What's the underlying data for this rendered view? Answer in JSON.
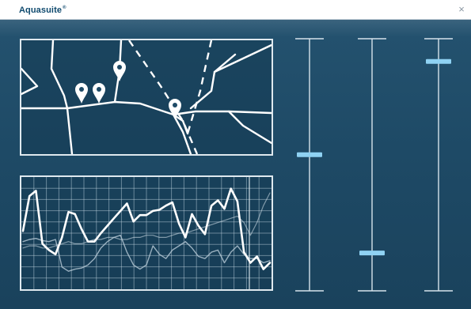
{
  "app": {
    "title": "Aquasuite",
    "trademark": "®",
    "close_icon": "close-icon",
    "close_glyph": "×"
  },
  "colors": {
    "background": "#1d4763",
    "line": "#ffffff",
    "handle": "#8fd2f3",
    "title": "#0f4a6e"
  },
  "map": {
    "markers": [
      {
        "name": "map-pin-1",
        "icon": "map-pin-icon"
      },
      {
        "name": "map-pin-2",
        "icon": "map-pin-icon"
      },
      {
        "name": "map-pin-3",
        "icon": "map-pin-icon"
      },
      {
        "name": "map-pin-4",
        "icon": "map-pin-icon"
      }
    ]
  },
  "chart_data": {
    "type": "line",
    "title": "",
    "xlabel": "",
    "ylabel": "",
    "grid": true,
    "ylim": [
      0,
      100
    ],
    "x": [
      0,
      1,
      2,
      3,
      4,
      5,
      6,
      7,
      8,
      9,
      10,
      11,
      12,
      13,
      14,
      15,
      16,
      17,
      18,
      19,
      20,
      21,
      22,
      23,
      24,
      25,
      26,
      27,
      28,
      29,
      30,
      31,
      32,
      33,
      34,
      35,
      36,
      37,
      38
    ],
    "series": [
      {
        "values": [
          52,
          85,
          90,
          40,
          34,
          30,
          46,
          70,
          68,
          54,
          42,
          42,
          50,
          57,
          64,
          71,
          78,
          61,
          67,
          67,
          71,
          72,
          76,
          79,
          59,
          46,
          68,
          57,
          49,
          76,
          81,
          73,
          92,
          80,
          32,
          22,
          28,
          16,
          22
        ]
      },
      {
        "values": [
          42,
          44,
          45,
          43,
          42,
          44,
          18,
          14,
          16,
          17,
          20,
          26,
          36,
          42,
          46,
          48,
          32,
          20,
          16,
          20,
          38,
          30,
          26,
          34,
          38,
          42,
          36,
          28,
          26,
          32,
          34,
          22,
          32,
          38,
          30,
          26,
          26,
          22,
          24
        ]
      },
      {
        "values": [
          36,
          38,
          38,
          36,
          36,
          38,
          40,
          42,
          40,
          40,
          42,
          44,
          44,
          46,
          46,
          44,
          44,
          46,
          46,
          48,
          48,
          46,
          46,
          48,
          50,
          50,
          52,
          54,
          56,
          58,
          60,
          62,
          64,
          66,
          60,
          48,
          60,
          76,
          88
        ]
      }
    ]
  },
  "sliders": [
    {
      "name": "slider-1",
      "value": 0.54
    },
    {
      "name": "slider-2",
      "value": 0.15
    },
    {
      "name": "slider-3",
      "value": 0.91
    }
  ]
}
